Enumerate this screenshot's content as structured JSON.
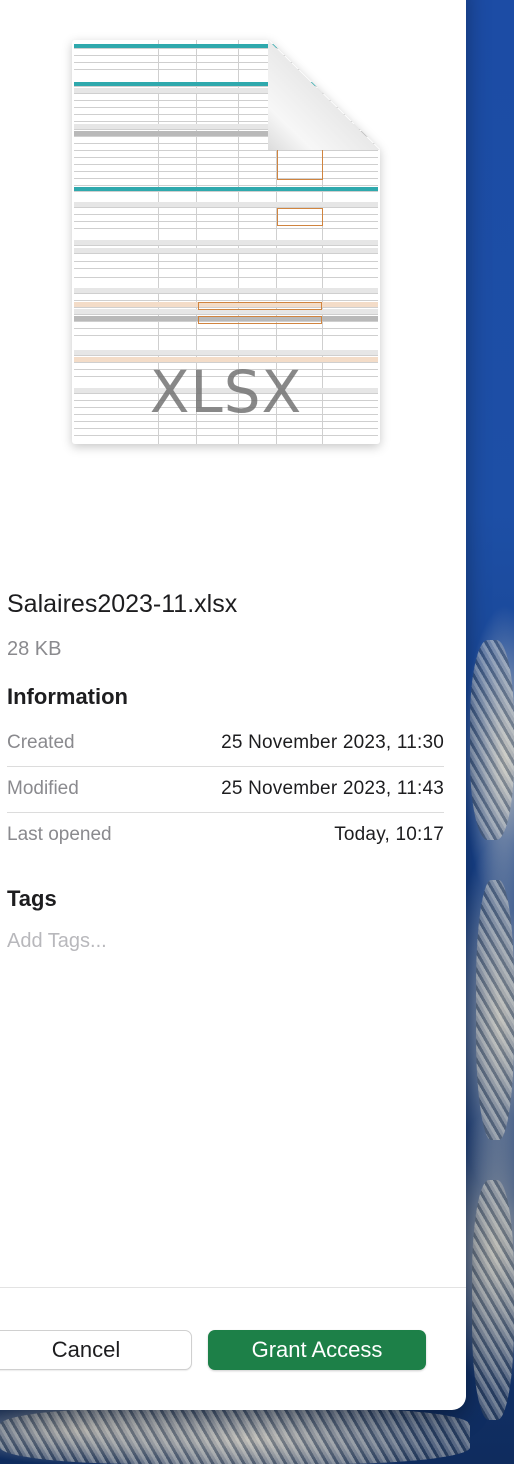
{
  "file": {
    "name": "Salaires2023-11.xlsx",
    "size": "28 KB",
    "type_badge": "XLSX"
  },
  "information": {
    "title": "Information",
    "rows": [
      {
        "label": "Created",
        "value": "25 November 2023, 11:30"
      },
      {
        "label": "Modified",
        "value": "25 November 2023, 11:43"
      },
      {
        "label": "Last opened",
        "value": "Today, 10:17"
      }
    ]
  },
  "tags": {
    "title": "Tags",
    "placeholder": "Add Tags..."
  },
  "buttons": {
    "cancel": "Cancel",
    "grant": "Grant Access"
  },
  "colors": {
    "accent_button": "#1d8048",
    "thumbnail_header": "#2fa9ad",
    "thumbnail_highlight": "#d0843f"
  }
}
